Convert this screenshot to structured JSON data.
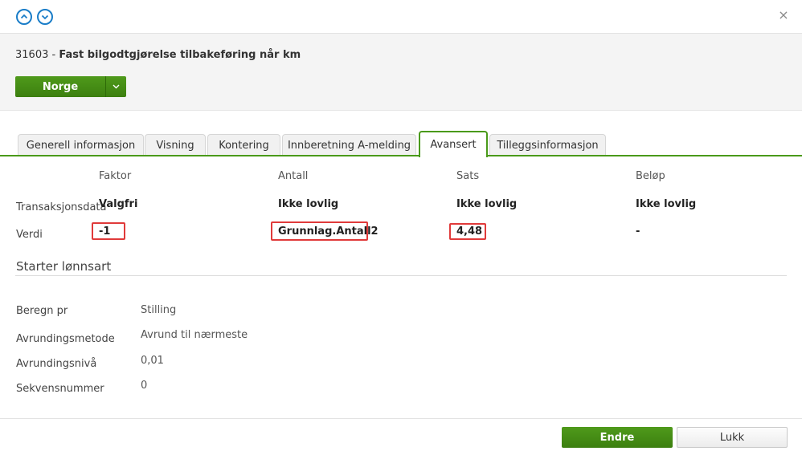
{
  "title": {
    "code": "31603",
    "separator": " - ",
    "name": "Fast bilgodtgjørelse tilbakeføring når km"
  },
  "country_button": {
    "label": "Norge"
  },
  "tabs": [
    {
      "label": "Generell informasjon"
    },
    {
      "label": "Visning"
    },
    {
      "label": "Kontering"
    },
    {
      "label": "Innberetning A-melding"
    },
    {
      "label": "Avansert",
      "active": true
    },
    {
      "label": "Tilleggsinformasjon"
    }
  ],
  "grid": {
    "columns": [
      "Faktor",
      "Antall",
      "Sats",
      "Beløp"
    ],
    "rows": [
      {
        "label": "Transaksjonsdata",
        "values": [
          "Valgfri",
          "Ikke lovlig",
          "Ikke lovlig",
          "Ikke lovlig"
        ]
      },
      {
        "label": "Verdi",
        "values": [
          "-1",
          "Grunnlag.Antall2",
          "4,48",
          "-"
        ]
      }
    ]
  },
  "section": {
    "title": "Starter lønnsart",
    "fields": [
      {
        "label": "Beregn pr",
        "value": "Stilling"
      },
      {
        "label": "Avrundingsmetode",
        "value": "Avrund til nærmeste"
      },
      {
        "label": "Avrundingsnivå",
        "value": "0,01"
      },
      {
        "label": "Sekvensnummer",
        "value": "0"
      }
    ]
  },
  "footer": {
    "primary_label": "Endre",
    "secondary_label": "Lukk"
  },
  "icons": {
    "up": "chevron-up-icon",
    "down": "chevron-down-icon",
    "close": "close-icon",
    "caret": "caret-down-icon"
  },
  "colors": {
    "accent_green": "#3c7f0f",
    "nav_blue": "#1a7dc8",
    "highlight_red": "#e03a3a"
  }
}
